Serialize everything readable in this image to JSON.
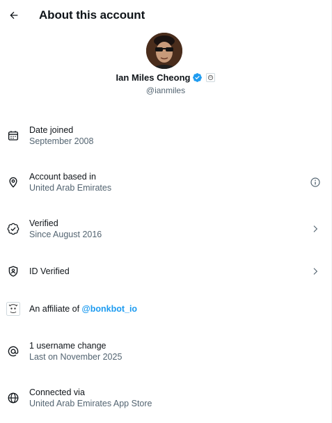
{
  "header": {
    "title": "About this account",
    "back_icon": "arrow-left-icon"
  },
  "profile": {
    "display_name": "Ian Miles Cheong",
    "handle": "@ianmiles",
    "verified_badge_color": "#1d9bf0"
  },
  "rows": {
    "date_joined": {
      "label": "Date joined",
      "value": "September 2008",
      "icon": "calendar-icon"
    },
    "based_in": {
      "label": "Account based in",
      "value": "United Arab Emirates",
      "icon": "location-pin-icon",
      "right_icon": "info-icon"
    },
    "verified": {
      "label": "Verified",
      "value": "Since August 2016",
      "icon": "verified-check-icon",
      "right_icon": "chevron-right-icon"
    },
    "id_verified": {
      "label": "ID Verified",
      "icon": "id-shield-icon",
      "right_icon": "chevron-right-icon"
    },
    "affiliate": {
      "label": "An affiliate of",
      "link": "@bonkbot_io",
      "icon": "affiliate-logo-icon"
    },
    "username": {
      "label": "1 username change",
      "value": "Last on November 2025",
      "icon": "at-sign-icon"
    },
    "connected": {
      "label": "Connected via",
      "value": "United Arab Emirates App Store",
      "icon": "globe-icon"
    }
  },
  "colors": {
    "link": "#1d9bf0",
    "secondary_text": "#536471",
    "primary_text": "#0f1419"
  }
}
